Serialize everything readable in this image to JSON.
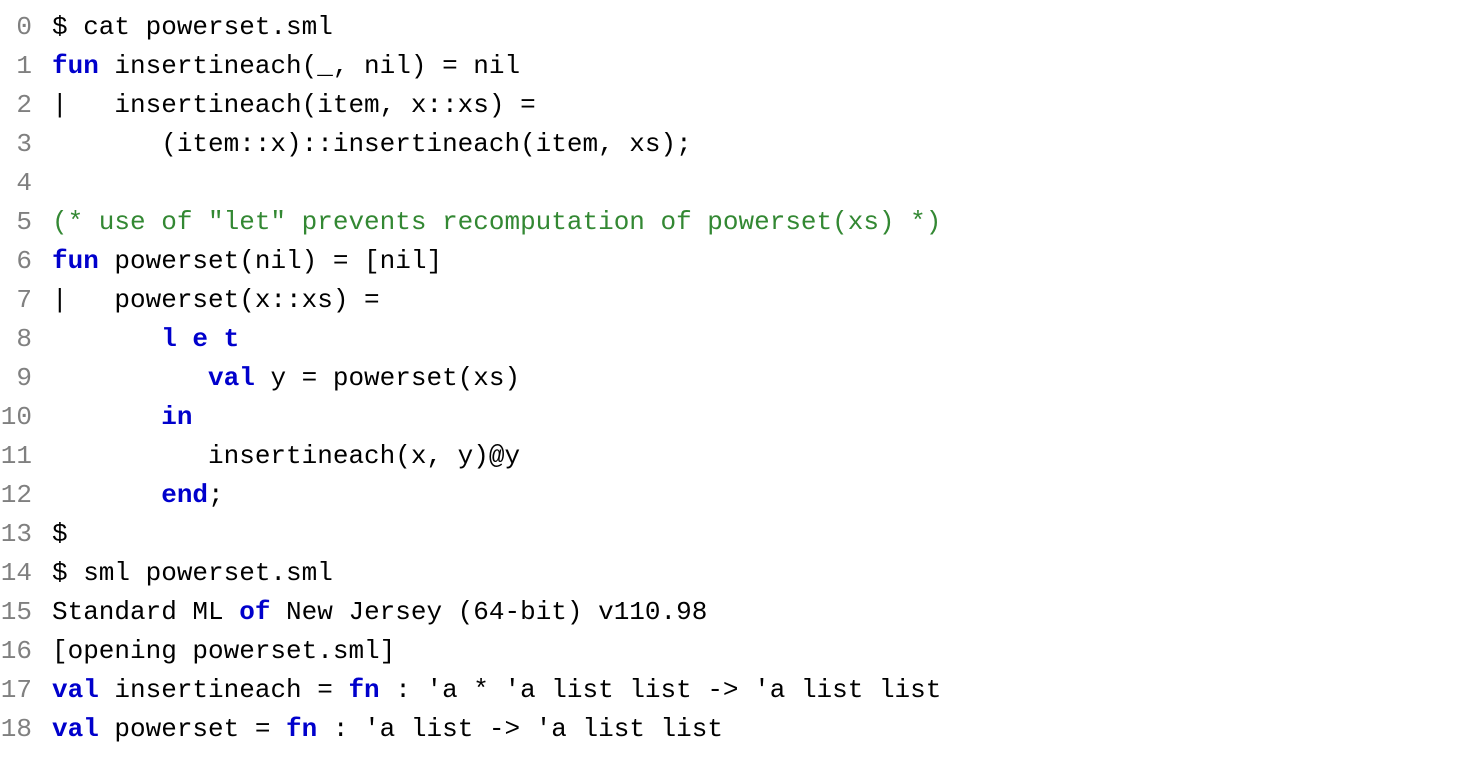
{
  "code": {
    "lines": [
      {
        "num": "0",
        "tokens": [
          {
            "cls": "tok-plain",
            "text": "$ cat powerset.sml"
          }
        ]
      },
      {
        "num": "1",
        "tokens": [
          {
            "cls": "tok-keyword",
            "text": "fun"
          },
          {
            "cls": "tok-plain",
            "text": " insertineach(_, nil) = nil"
          }
        ]
      },
      {
        "num": "2",
        "tokens": [
          {
            "cls": "tok-plain",
            "text": "|   insertineach(item, x::xs) ="
          }
        ]
      },
      {
        "num": "3",
        "tokens": [
          {
            "cls": "tok-plain",
            "text": "       (item::x)::insertineach(item, xs);"
          }
        ]
      },
      {
        "num": "4",
        "tokens": []
      },
      {
        "num": "5",
        "tokens": [
          {
            "cls": "tok-comment",
            "text": "(* use of \"let\" prevents recomputation of powerset(xs) *)"
          }
        ]
      },
      {
        "num": "6",
        "tokens": [
          {
            "cls": "tok-keyword",
            "text": "fun"
          },
          {
            "cls": "tok-plain",
            "text": " powerset(nil) = [nil]"
          }
        ]
      },
      {
        "num": "7",
        "tokens": [
          {
            "cls": "tok-plain",
            "text": "|   powerset(x::xs) ="
          }
        ]
      },
      {
        "num": "8",
        "tokens": [
          {
            "cls": "tok-plain",
            "text": "       "
          },
          {
            "cls": "tok-keyword",
            "text": "l e t"
          }
        ]
      },
      {
        "num": "9",
        "tokens": [
          {
            "cls": "tok-plain",
            "text": "          "
          },
          {
            "cls": "tok-keyword",
            "text": "val"
          },
          {
            "cls": "tok-plain",
            "text": " y = powerset(xs)"
          }
        ]
      },
      {
        "num": "10",
        "tokens": [
          {
            "cls": "tok-plain",
            "text": "       "
          },
          {
            "cls": "tok-keyword",
            "text": "in"
          }
        ]
      },
      {
        "num": "11",
        "tokens": [
          {
            "cls": "tok-plain",
            "text": "          insertineach(x, y)@y"
          }
        ]
      },
      {
        "num": "12",
        "tokens": [
          {
            "cls": "tok-plain",
            "text": "       "
          },
          {
            "cls": "tok-keyword",
            "text": "end"
          },
          {
            "cls": "tok-plain",
            "text": ";"
          }
        ]
      },
      {
        "num": "13",
        "tokens": [
          {
            "cls": "tok-plain",
            "text": "$"
          }
        ]
      },
      {
        "num": "14",
        "tokens": [
          {
            "cls": "tok-plain",
            "text": "$ sml powerset.sml"
          }
        ]
      },
      {
        "num": "15",
        "tokens": [
          {
            "cls": "tok-plain",
            "text": "Standard ML "
          },
          {
            "cls": "tok-keyword",
            "text": "of"
          },
          {
            "cls": "tok-plain",
            "text": " New Jersey (64-bit) v110.98"
          }
        ]
      },
      {
        "num": "16",
        "tokens": [
          {
            "cls": "tok-plain",
            "text": "[opening powerset.sml]"
          }
        ]
      },
      {
        "num": "17",
        "tokens": [
          {
            "cls": "tok-keyword",
            "text": "val"
          },
          {
            "cls": "tok-plain",
            "text": " insertineach = "
          },
          {
            "cls": "tok-keyword",
            "text": "fn"
          },
          {
            "cls": "tok-plain",
            "text": " : 'a * 'a list list -> 'a list list"
          }
        ]
      },
      {
        "num": "18",
        "tokens": [
          {
            "cls": "tok-keyword",
            "text": "val"
          },
          {
            "cls": "tok-plain",
            "text": " powerset = "
          },
          {
            "cls": "tok-keyword",
            "text": "fn"
          },
          {
            "cls": "tok-plain",
            "text": " : 'a list -> 'a list list"
          }
        ]
      }
    ]
  }
}
